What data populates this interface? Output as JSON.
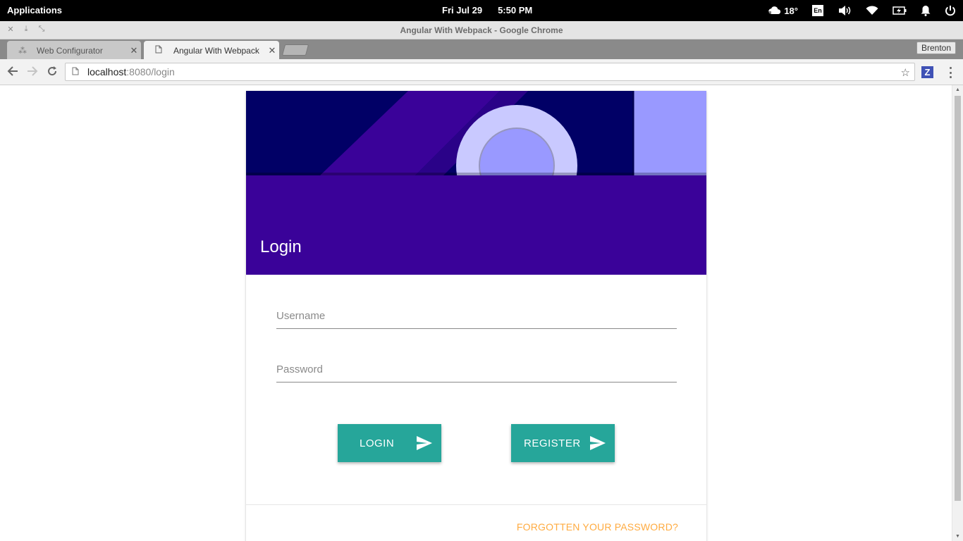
{
  "system_panel": {
    "apps_label": "Applications",
    "date": "Fri Jul 29",
    "time": "5:50 PM",
    "temperature": "18°",
    "keyboard_layout": "En",
    "icons": [
      "weather-icon",
      "keyboard-layout-icon",
      "volume-icon",
      "wifi-icon",
      "battery-icon",
      "notification-bell-icon",
      "power-icon"
    ]
  },
  "window": {
    "title": "Angular With Webpack - Google Chrome"
  },
  "tabs": [
    {
      "label": "Web Configurator",
      "active": false
    },
    {
      "label": "Angular With Webpack",
      "active": true
    }
  ],
  "profile_name": "Brenton",
  "address_bar": {
    "host": "localhost",
    "path": ":8080/login"
  },
  "extension_label": "Z",
  "login_card": {
    "title": "Login",
    "username_placeholder": "Username",
    "password_placeholder": "Password",
    "login_button": "LOGIN",
    "register_button": "REGISTER",
    "forgot_link": "FORGOTTEN YOUR PASSWORD?"
  },
  "colors": {
    "header_purple": "#3a0299",
    "hero_navy": "#010066",
    "hero_lavender": "#9999ff",
    "button_teal": "#26a69a",
    "link_orange": "#ffab40"
  }
}
